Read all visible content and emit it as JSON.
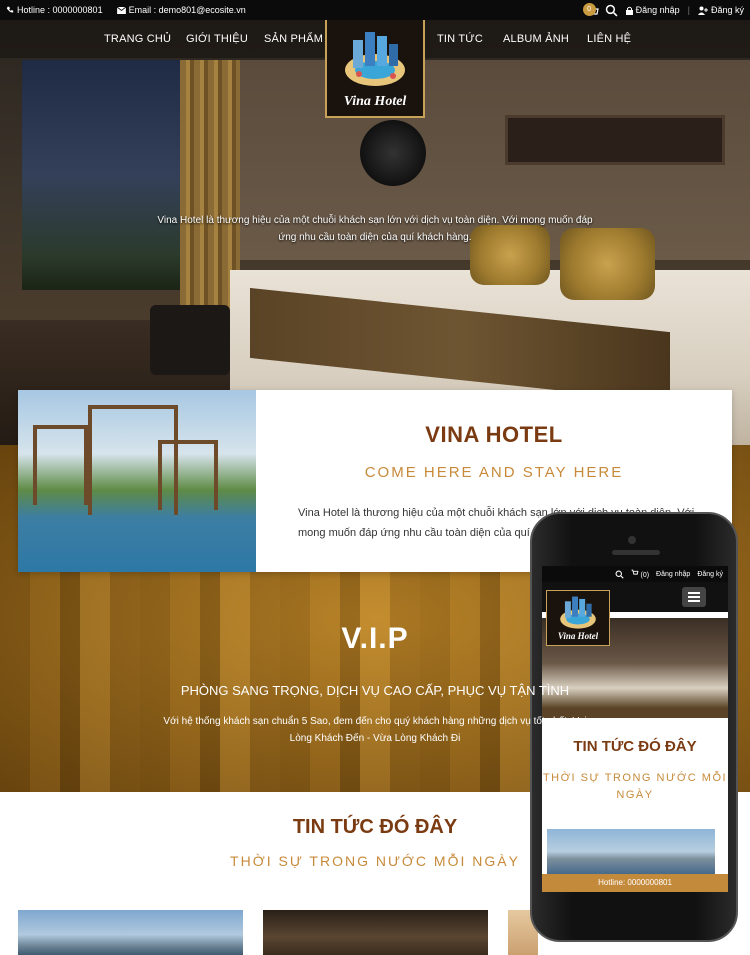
{
  "topbar": {
    "hotline": "Hotline : 0000000801",
    "email": "Email : demo801@ecosite.vn",
    "cart_count": "0",
    "login": "Đăng nhập",
    "register": "Đăng ký"
  },
  "nav": {
    "items": [
      "TRANG CHỦ",
      "GIỚI THIỆU",
      "SẢN PHẨM",
      "TIN TỨC",
      "ALBUM ẢNH",
      "LIÊN HỆ"
    ]
  },
  "logo": {
    "text": "Vina Hotel"
  },
  "hero": {
    "text": "Vina Hotel là thương hiệu của một chuỗi khách sạn lớn với dịch vụ toàn diện. Với mong muốn đáp ứng nhu cầu toàn diện của quí khách hàng."
  },
  "intro": {
    "title": "VINA HOTEL",
    "subtitle": "COME HERE AND STAY HERE",
    "description": "Vina Hotel là thương hiệu của một chuỗi khách sạn lớn với dịch vụ toàn diện. Với mong muốn đáp ứng nhu cầu toàn diện của quí khách hàng."
  },
  "vip": {
    "title": "V.I.P",
    "subtitle": "PHÒNG SANG TRỌNG, DỊCH VỤ CAO CẤP, PHỤC VỤ TẬN TÌNH",
    "description": "Với hệ thống khách sạn chuẩn 5 Sao, đem đến cho quý khách hàng những dịch vụ tốt nhất, Vui Lòng Khách Đến - Vừa Lòng Khách Đi"
  },
  "news": {
    "title": "TIN TỨC ĐÓ ĐÂY",
    "subtitle": "THỜI SỰ TRONG NƯỚC MỖI NGÀY"
  },
  "mobile": {
    "cart": "(0)",
    "login": "Đăng nhập",
    "register": "Đăng ký",
    "logo_text": "Vina Hotel",
    "news_title": "TIN TỨC ĐÓ ĐÂY",
    "news_subtitle": "THỜI SỰ TRONG NƯỚC MỖI NGÀY",
    "hotline": "Hotline: 0000000801"
  },
  "colors": {
    "brand_brown": "#7b3b12",
    "accent_gold": "#c78a3a",
    "topbar": "#0b0b0b"
  }
}
